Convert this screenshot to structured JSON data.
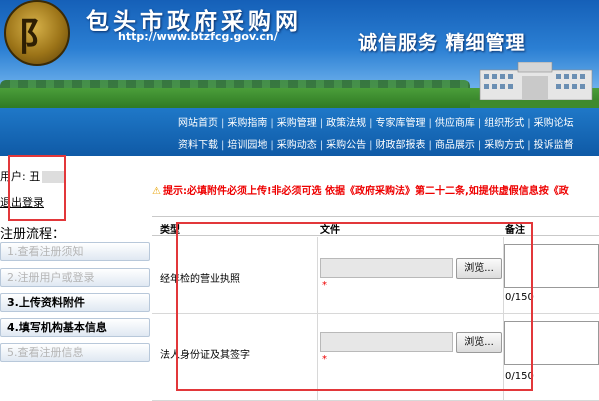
{
  "header": {
    "logo_glyph": "阝",
    "site_title": "包头市政府采购网",
    "site_url": "http://www.btzfcg.gov.cn/",
    "slogan": "诚信服务    精细管理"
  },
  "nav": {
    "row1": [
      "网站首页",
      "采购指南",
      "采购管理",
      "政策法规",
      "专家库管理",
      "供应商库",
      "组织形式",
      "采购论坛"
    ],
    "row2": [
      "资料下载",
      "培训园地",
      "采购动态",
      "采购公告",
      "财政部报表",
      "商品展示",
      "采购方式",
      "投诉监督"
    ]
  },
  "sidebar": {
    "user_label": "用户: 丑",
    "logout": "退出登录",
    "steps_title": "注册流程：",
    "steps": [
      {
        "label": "1.查看注册须知",
        "state": "dim"
      },
      {
        "label": "2.注册用户或登录",
        "state": "dim"
      },
      {
        "label": "3.上传资料附件",
        "state": "active"
      },
      {
        "label": "4.填写机构基本信息",
        "state": "active"
      },
      {
        "label": "5.查看注册信息",
        "state": "dim"
      }
    ]
  },
  "notice": {
    "icon": "warning-icon",
    "text_red": "提示:必填附件必须上传!非必须可选",
    "text_black": " 依据《政府采购法》第二十二条,如提供虚假信息按《政"
  },
  "table": {
    "headers": {
      "type": "类型",
      "file": "文件",
      "note": "备注"
    },
    "rows": [
      {
        "label": "经年检的营业执照",
        "browse": "浏览...",
        "required": "*",
        "count": "0/150"
      },
      {
        "label": "法人身份证及其签字",
        "browse": "浏览...",
        "required": "*",
        "count": "0/150"
      }
    ]
  },
  "colors": {
    "accent_blue": "#1560b8",
    "highlight_red": "#e2373a"
  }
}
